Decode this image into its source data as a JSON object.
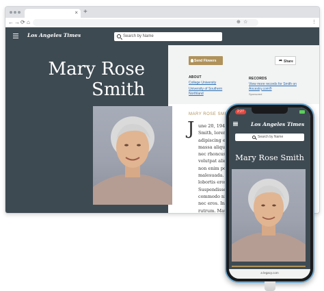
{
  "browser": {
    "tab_close": "×",
    "new_tab": "+",
    "nav": {
      "back": "←",
      "forward": "→",
      "reload": "⟳",
      "home": "⌂"
    },
    "toolbar_icons": [
      "⊕",
      "☆",
      "⋮"
    ]
  },
  "site": {
    "logo": "Los Angeles Times",
    "search_placeholder": "Search by Name"
  },
  "obituary": {
    "name_line1": "Mary Rose",
    "name_line2": "Smith",
    "buttons": {
      "send_flowers": "Send Flowers",
      "share": "Share"
    },
    "about": {
      "heading": "ABOUT",
      "links": [
        "College University",
        "University of Southern Northland"
      ]
    },
    "records": {
      "heading": "RECORDS",
      "link": "View more records for Smith on Ancestry.com®",
      "sponsored": "Sponsored"
    },
    "section_heading": "MARY ROSE SMITH",
    "drop_cap": "J",
    "body_lines": [
      "une 20, 1943 – Ma",
      "Smith, lorem ipsum",
      "adipiscing elit. M",
      "massa aliquet, ve",
      "nec rhoncus est, a",
      "volutpat aliquet e",
      "non enim porttitor",
      "malesuada. In hac",
      "lobortis eros sit a",
      "Suspendisse temp",
      "commodo nibh vel",
      "nec eros. Integer",
      "rutrum. Mauris ve"
    ]
  },
  "phone": {
    "time": "2:27",
    "logo": "Los Angeles Times",
    "search_placeholder": "Search by Name",
    "name": "Mary Rose Smith",
    "url": "a legacy.com"
  },
  "colors": {
    "header_bg": "#3e4a52",
    "accent_gold": "#b0925a",
    "link_blue": "#2a6cb0",
    "phone_frame": "#6aa7cf"
  }
}
